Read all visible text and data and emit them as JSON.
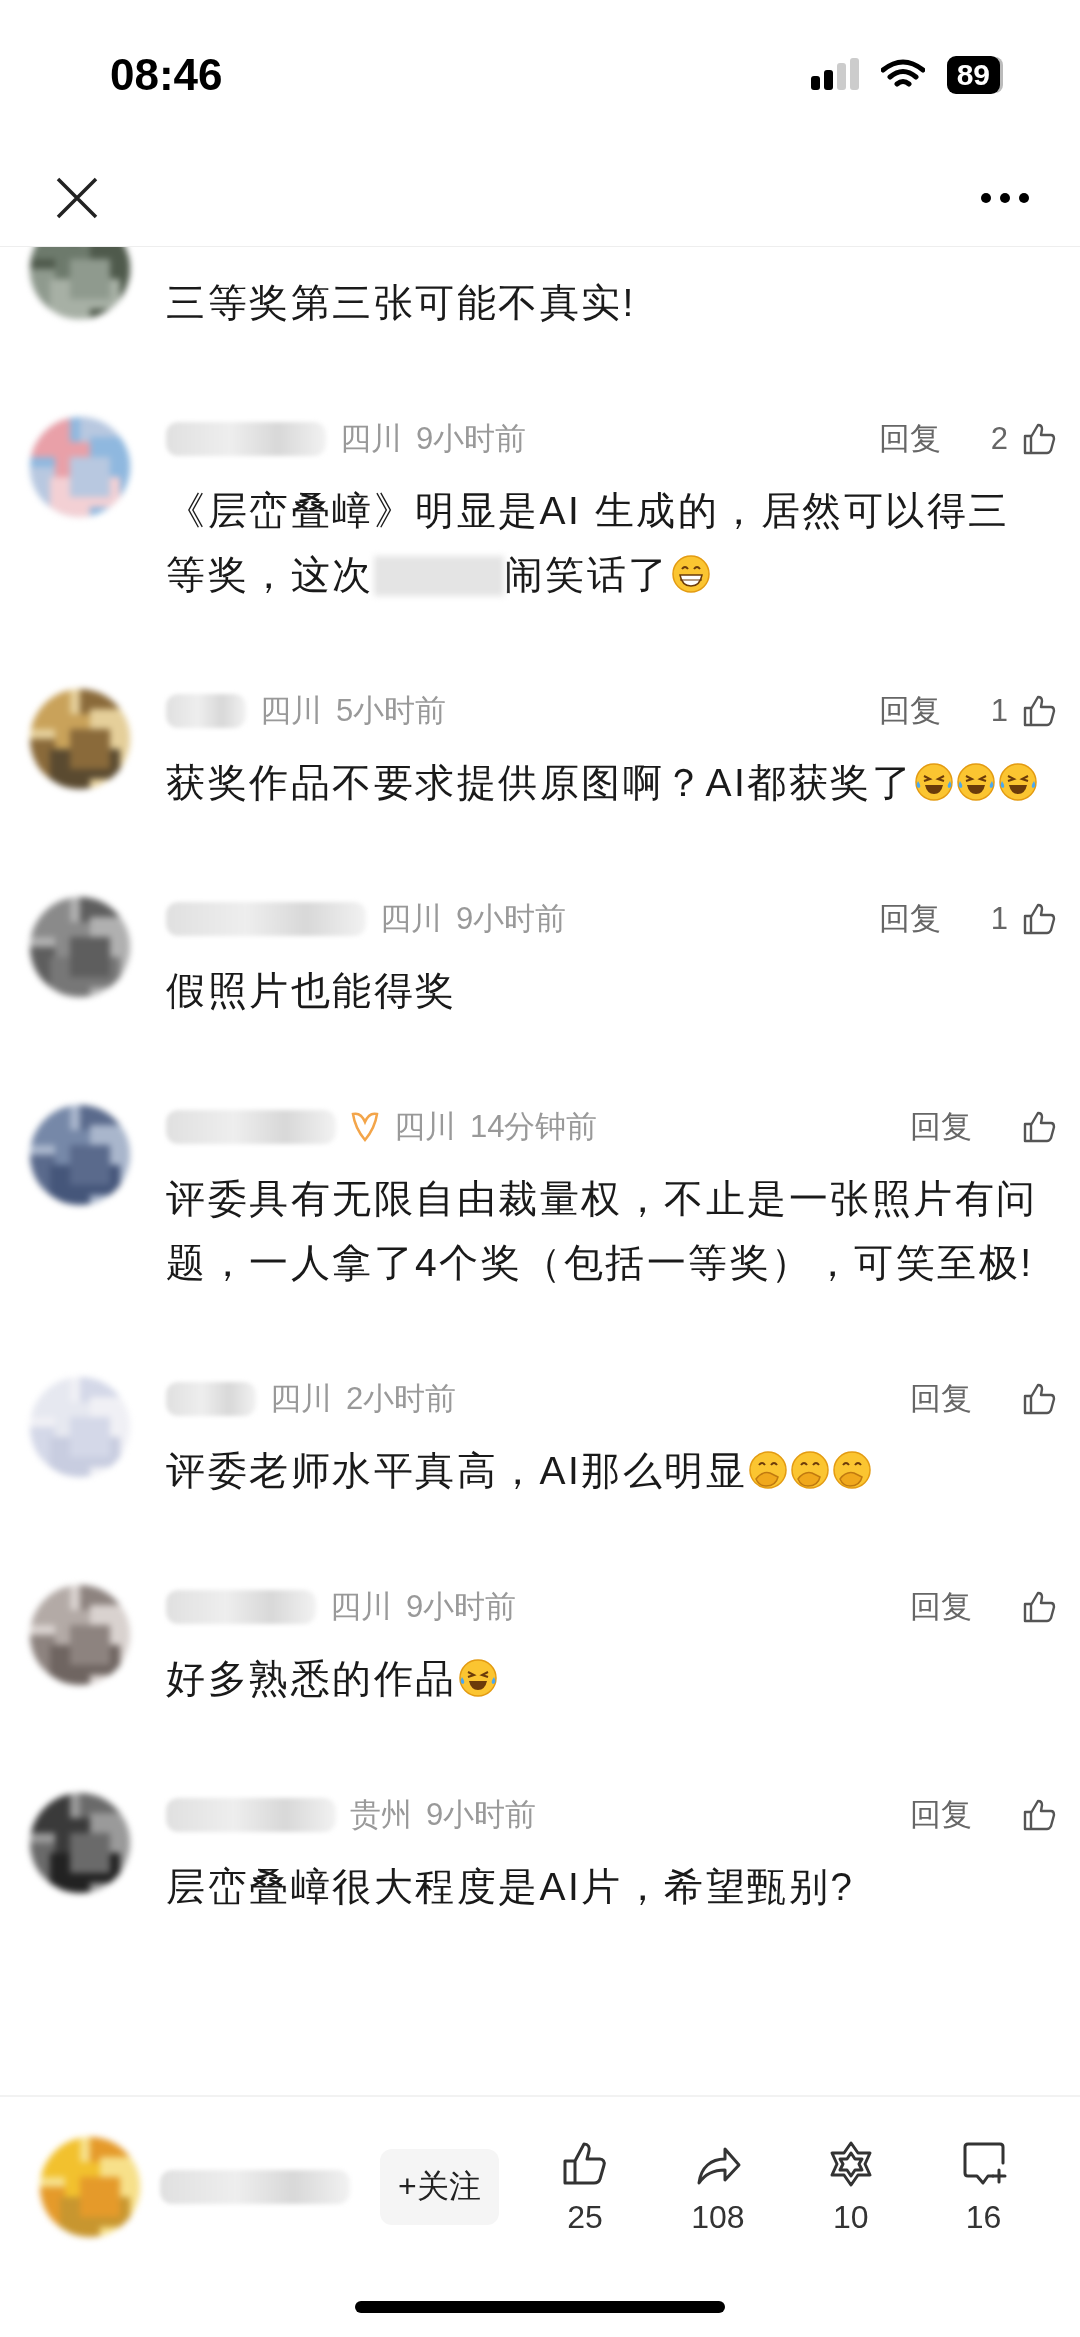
{
  "status_bar": {
    "time": "08:46",
    "battery": "89"
  },
  "comments": [
    {
      "meta_hidden": true,
      "body": [
        {
          "kind": "text",
          "text": "三等奖第三张可能不真实!"
        }
      ]
    },
    {
      "location": "四川",
      "time": "9小时前",
      "reply": "回复",
      "likes": "2",
      "body": [
        {
          "kind": "text",
          "text": "《层峦叠嶂》明显是AI 生成的，居然可以得三"
        },
        {
          "kind": "text",
          "text": "等奖，这次"
        },
        {
          "kind": "redacted"
        },
        {
          "kind": "text",
          "text": "闹笑话了"
        },
        {
          "kind": "grin"
        }
      ]
    },
    {
      "location": "四川",
      "time": "5小时前",
      "reply": "回复",
      "likes": "1",
      "body": [
        {
          "kind": "text",
          "text": "获奖作品不要求提供原图啊？AI都获奖了"
        },
        {
          "kind": "tears"
        },
        {
          "kind": "tears"
        },
        {
          "kind": "tears"
        }
      ]
    },
    {
      "location": "四川",
      "time": "9小时前",
      "reply": "回复",
      "likes": "1",
      "body": [
        {
          "kind": "text",
          "text": "假照片也能得奖"
        }
      ]
    },
    {
      "badge": true,
      "location": "四川",
      "time": "14分钟前",
      "reply": "回复",
      "body": [
        {
          "kind": "text",
          "text": "评委具有无限自由裁量权，不止是一张照片有问题，一人拿了4个奖（包括一等奖），可笑至极!"
        }
      ]
    },
    {
      "location": "四川",
      "time": "2小时前",
      "reply": "回复",
      "body": [
        {
          "kind": "text",
          "text": "评委老师水平真高，AI那么明显"
        },
        {
          "kind": "giggle"
        },
        {
          "kind": "giggle"
        },
        {
          "kind": "giggle"
        }
      ]
    },
    {
      "location": "四川",
      "time": "9小时前",
      "reply": "回复",
      "body": [
        {
          "kind": "text",
          "text": "好多熟悉的作品"
        },
        {
          "kind": "tears"
        }
      ]
    },
    {
      "location": "贵州",
      "time": "9小时前",
      "reply": "回复",
      "body": [
        {
          "kind": "text",
          "text": "层峦叠嶂很大程度是AI片，希望甄别?"
        }
      ]
    }
  ],
  "bottom_bar": {
    "follow": "+关注",
    "actions": [
      {
        "kind": "like",
        "count": "25"
      },
      {
        "kind": "share",
        "count": "108"
      },
      {
        "kind": "star",
        "count": "10"
      },
      {
        "kind": "comment",
        "count": "16"
      }
    ]
  }
}
